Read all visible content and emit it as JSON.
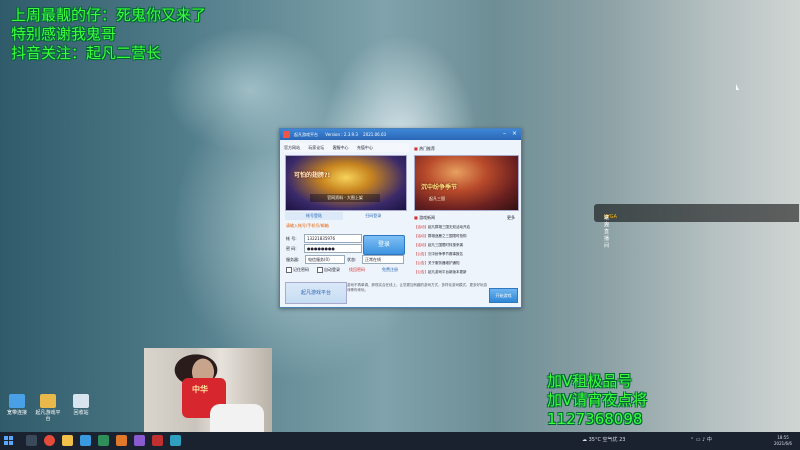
{
  "overlay": {
    "line1": "上周最靓的仔：死鬼你又来了",
    "line2": "特别感谢我鬼哥",
    "line3": "抖音关注：起凡二营长",
    "right1": "加V租极品号",
    "right2": "加V请宵夜点将",
    "right3": "1127368098"
  },
  "desktop_icons": [
    {
      "label": "宽带连接",
      "icon": "network-icon",
      "color": "#4aa0e6"
    },
    {
      "label": "起凡游戏平台",
      "icon": "folder-icon",
      "color": "#e8b84a"
    },
    {
      "label": "回收站",
      "icon": "recycle-bin-icon",
      "color": "#d8e4ee"
    }
  ],
  "app": {
    "title": "起凡游戏平台",
    "version": "Version : 2.3.9.3",
    "date": "2021.06.03",
    "menu": [
      "官方网站",
      "玩家论坛",
      "客服中心",
      "充值中心"
    ],
    "hot_header": "热门推荐",
    "banner_left_title": "可怕的翅膀?!",
    "banner_left_sub": "官网资料 · 大图上架",
    "banner_right_title": "沉中纷争季节",
    "banner_right_sub": "起凡三国",
    "tab_account": "帐号登陆",
    "tab_qr": "扫码登录",
    "login_hint": "请输入帐号/手机号/邮箱",
    "account_label": "帐 号:",
    "account_value": "13221835976",
    "password_label": "密 码:",
    "password_value": "●●●●●●●●",
    "login_button": "登录",
    "server_label": "服务器:",
    "server_value": "电信服务(0)",
    "status_label": "状态:",
    "status_value": "正常在线",
    "remember": "记住密码",
    "auto_login": "自动登录",
    "forgot": "找回密码",
    "register": "免费注册",
    "footer_logo": "起凡游戏平台",
    "footer_note": "游戏不再单调，即现实合在线上，让您更加有趣的游戏方式，多样化游戏模式，更多好玩游戏等你来玩。",
    "start_button": "开始游戏",
    "notice_header": "游戏新闻",
    "notice_more": "更多",
    "notices": [
      {
        "tag": "【活动】",
        "text": "起凡群雄三国无双活动开启"
      },
      {
        "tag": "【活动】",
        "text": "群雄逐鹿之三国限时抢购"
      },
      {
        "tag": "【活动】",
        "text": "起凡三国限时特惠来袭"
      },
      {
        "tag": "【公告】",
        "text": "沉中纷争季节赛事报名"
      },
      {
        "tag": "【公告】",
        "text": "关于服务器维护通知"
      },
      {
        "tag": "【公告】",
        "text": "起凡游戏平台新版本更新"
      }
    ]
  },
  "chat_bar": {
    "prefix": "欢迎",
    "name": "LVGA",
    "suffix": "进入直播间"
  },
  "taskbar": {
    "weather": "35°C 空气优 23",
    "time": "18:55",
    "date": "2021/6/6",
    "apps": [
      {
        "icon": "search-icon",
        "color": "#3a4a5a"
      },
      {
        "icon": "chrome-icon",
        "color": "#e44b3a"
      },
      {
        "icon": "folder-icon",
        "color": "#f0c04a"
      },
      {
        "icon": "app-icon",
        "color": "#3a9ae0"
      },
      {
        "icon": "app-icon",
        "color": "#2e8f5a"
      },
      {
        "icon": "app-icon",
        "color": "#e07a2a"
      },
      {
        "icon": "app-icon",
        "color": "#8a5ad0"
      },
      {
        "icon": "app-icon",
        "color": "#c03030"
      },
      {
        "icon": "app-icon",
        "color": "#30a0c0"
      }
    ]
  }
}
